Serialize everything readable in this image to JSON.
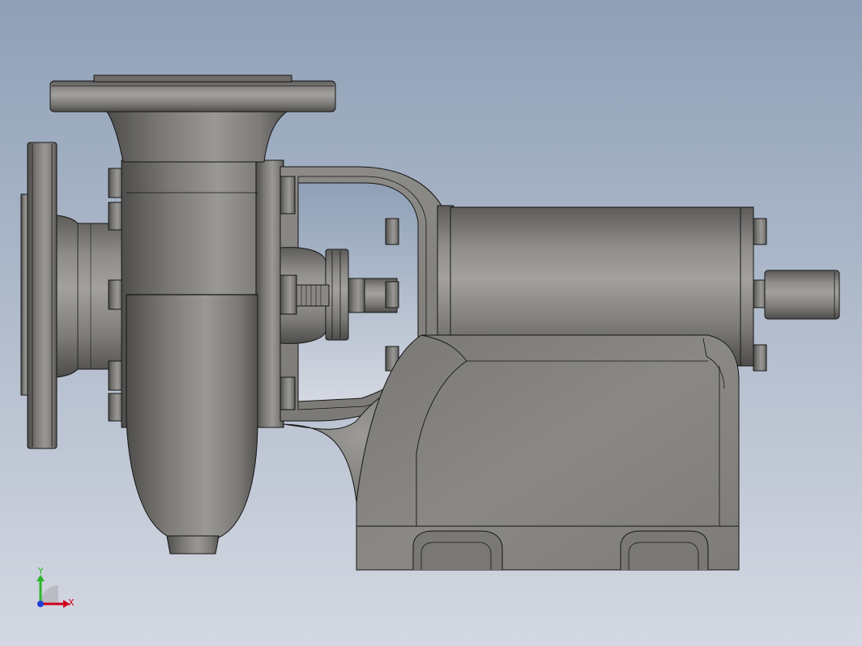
{
  "colors": {
    "bg_top": "#8fa0b6",
    "bg_bottom": "#d4d8e2",
    "metal_dark": "#4e4d4b",
    "metal_mid": "#8a8885",
    "metal_light": "#a7a5a2",
    "edge": "#151515",
    "axis_x": "#d0021b",
    "axis_y": "#2bb52b",
    "axis_z": "#1f3fd6"
  },
  "triad": {
    "x_label": "X",
    "y_label": "Y"
  }
}
